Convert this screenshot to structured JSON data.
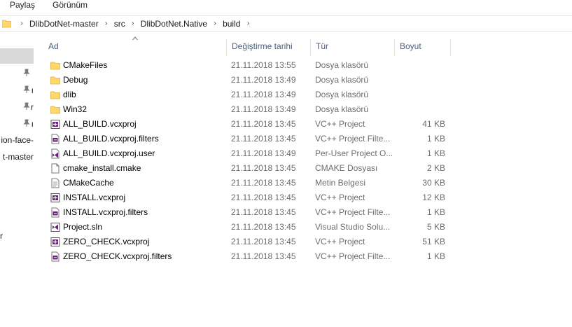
{
  "ribbon": {
    "tabs": [
      {
        "label": "Paylaş"
      },
      {
        "label": "Görünüm"
      }
    ]
  },
  "address": {
    "crumbs": [
      "DlibDotNet-master",
      "src",
      "DlibDotNet.Native",
      "build"
    ]
  },
  "nav": {
    "items": [
      {
        "label": ""
      },
      {
        "label": ""
      },
      {
        "label": "ı"
      },
      {
        "label": "r"
      },
      {
        "label": "ı"
      },
      {
        "label": "ion-face-"
      },
      {
        "label": "t-master"
      },
      {
        "label": ""
      },
      {
        "label": ""
      },
      {
        "label": "r"
      }
    ]
  },
  "columns": {
    "name": "Ad",
    "date": "Değiştirme tarihi",
    "type": "Tür",
    "size": "Boyut"
  },
  "files": [
    {
      "name": "CMakeFiles",
      "date": "21.11.2018 13:55",
      "type": "Dosya klasörü",
      "size": "",
      "icon": "folder"
    },
    {
      "name": "Debug",
      "date": "21.11.2018 13:49",
      "type": "Dosya klasörü",
      "size": "",
      "icon": "folder"
    },
    {
      "name": "dlib",
      "date": "21.11.2018 13:49",
      "type": "Dosya klasörü",
      "size": "",
      "icon": "folder"
    },
    {
      "name": "Win32",
      "date": "21.11.2018 13:49",
      "type": "Dosya klasörü",
      "size": "",
      "icon": "folder"
    },
    {
      "name": "ALL_BUILD.vcxproj",
      "date": "21.11.2018 13:45",
      "type": "VC++ Project",
      "size": "41 KB",
      "icon": "vcxproj"
    },
    {
      "name": "ALL_BUILD.vcxproj.filters",
      "date": "21.11.2018 13:45",
      "type": "VC++ Project Filte...",
      "size": "1 KB",
      "icon": "filters"
    },
    {
      "name": "ALL_BUILD.vcxproj.user",
      "date": "21.11.2018 13:49",
      "type": "Per-User Project O...",
      "size": "1 KB",
      "icon": "vs-user"
    },
    {
      "name": "cmake_install.cmake",
      "date": "21.11.2018 13:45",
      "type": "CMAKE Dosyası",
      "size": "2 KB",
      "icon": "blank"
    },
    {
      "name": "CMakeCache",
      "date": "21.11.2018 13:45",
      "type": "Metin Belgesi",
      "size": "30 KB",
      "icon": "text"
    },
    {
      "name": "INSTALL.vcxproj",
      "date": "21.11.2018 13:45",
      "type": "VC++ Project",
      "size": "12 KB",
      "icon": "vcxproj"
    },
    {
      "name": "INSTALL.vcxproj.filters",
      "date": "21.11.2018 13:45",
      "type": "VC++ Project Filte...",
      "size": "1 KB",
      "icon": "filters"
    },
    {
      "name": "Project.sln",
      "date": "21.11.2018 13:45",
      "type": "Visual Studio Solu...",
      "size": "5 KB",
      "icon": "sln"
    },
    {
      "name": "ZERO_CHECK.vcxproj",
      "date": "21.11.2018 13:45",
      "type": "VC++ Project",
      "size": "51 KB",
      "icon": "vcxproj"
    },
    {
      "name": "ZERO_CHECK.vcxproj.filters",
      "date": "21.11.2018 13:45",
      "type": "VC++ Project Filte...",
      "size": "1 KB",
      "icon": "filters"
    }
  ],
  "colors": {
    "folder": "#ffd86b",
    "folder_dark": "#e8b84a",
    "header_text": "#4c607a",
    "meta_text": "#6d6d6d",
    "vs_purple": "#68217a",
    "selection": "#d9d9d9"
  }
}
